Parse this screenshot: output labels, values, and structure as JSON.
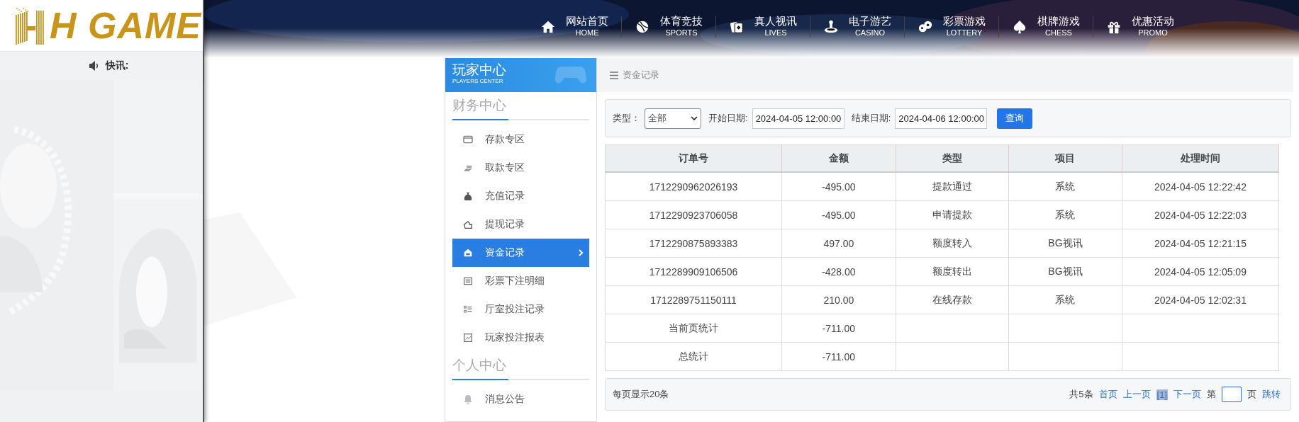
{
  "logo": {
    "text": "H GAME"
  },
  "news": {
    "label": "快讯:"
  },
  "nav": [
    {
      "label": "网站首页",
      "sublabel": "HOME"
    },
    {
      "label": "体育竞技",
      "sublabel": "SPORTS"
    },
    {
      "label": "真人视讯",
      "sublabel": "LIVES"
    },
    {
      "label": "电子游艺",
      "sublabel": "CASINO"
    },
    {
      "label": "彩票游戏",
      "sublabel": "LOTTERY"
    },
    {
      "label": "棋牌游戏",
      "sublabel": "CHESS"
    },
    {
      "label": "优惠活动",
      "sublabel": "PROMO"
    }
  ],
  "sidebar": {
    "title": "玩家中心",
    "subtitle": "PLAYERS CENTER",
    "sections": [
      {
        "heading": "财务中心",
        "items": [
          {
            "label": "存款专区",
            "selected": false
          },
          {
            "label": "取款专区",
            "selected": false
          },
          {
            "label": "充值记录",
            "selected": false
          },
          {
            "label": "提现记录",
            "selected": false
          },
          {
            "label": "资金记录",
            "selected": true
          },
          {
            "label": "彩票下注明细",
            "selected": false
          },
          {
            "label": "厅室投注记录",
            "selected": false
          },
          {
            "label": "玩家投注报表",
            "selected": false
          }
        ]
      },
      {
        "heading": "个人中心",
        "items": [
          {
            "label": "消息公告",
            "selected": false
          }
        ]
      }
    ]
  },
  "breadcrumb": "资金记录",
  "filter": {
    "type_label": "类型：",
    "type_value": "全部",
    "start_label": "开始日期:",
    "start_value": "2024-04-05 12:00:00",
    "end_label": "结束日期:",
    "end_value": "2024-04-06 12:00:00",
    "button": "查询"
  },
  "table": {
    "columns": [
      "订单号",
      "金额",
      "类型",
      "项目",
      "处理时间"
    ],
    "rows": [
      [
        "1712290962026193",
        "-495.00",
        "提款通过",
        "系统",
        "2024-04-05 12:22:42"
      ],
      [
        "1712290923706058",
        "-495.00",
        "申请提款",
        "系统",
        "2024-04-05 12:22:03"
      ],
      [
        "1712290875893383",
        "497.00",
        "额度转入",
        "BG视讯",
        "2024-04-05 12:21:15"
      ],
      [
        "1712289909106506",
        "-428.00",
        "额度转出",
        "BG视讯",
        "2024-04-05 12:05:09"
      ],
      [
        "1712289751150111",
        "210.00",
        "在线存款",
        "系统",
        "2024-04-05 12:02:31"
      ],
      [
        "当前页统计",
        "-711.00"
      ],
      [
        "总统计",
        "-711.00"
      ]
    ]
  },
  "pagination": {
    "per_page": "每页显示20条",
    "total": "共5条",
    "first": "首页",
    "prev": "上一页",
    "current": "[1]",
    "next": "下一页",
    "goto_prefix": "第",
    "goto_suffix": "页",
    "goto_button": "跳转"
  }
}
